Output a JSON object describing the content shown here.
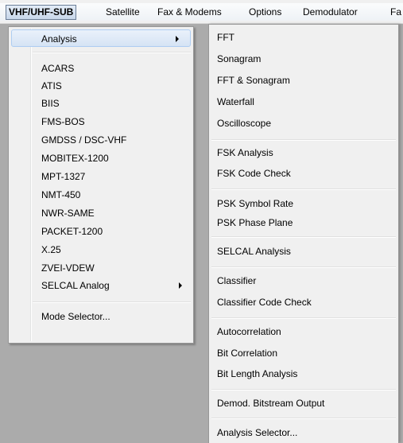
{
  "menubar": {
    "items": [
      {
        "label": "VHF/UHF-SUB"
      },
      {
        "label": "Satellite"
      },
      {
        "label": "Fax & Modems"
      },
      {
        "label": "Options"
      },
      {
        "label": "Demodulator"
      },
      {
        "label": "Fa"
      }
    ]
  },
  "left_menu": {
    "items": [
      {
        "label": "Analysis",
        "submenu": true
      },
      {
        "label": "ACARS"
      },
      {
        "label": "ATIS"
      },
      {
        "label": "BIIS"
      },
      {
        "label": "FMS-BOS"
      },
      {
        "label": "GMDSS / DSC-VHF"
      },
      {
        "label": "MOBITEX-1200"
      },
      {
        "label": "MPT-1327"
      },
      {
        "label": "NMT-450"
      },
      {
        "label": "NWR-SAME"
      },
      {
        "label": "PACKET-1200"
      },
      {
        "label": "X.25"
      },
      {
        "label": "ZVEI-VDEW"
      },
      {
        "label": "SELCAL Analog",
        "submenu": true
      },
      {
        "label": "Mode Selector..."
      }
    ]
  },
  "right_menu": {
    "items": [
      {
        "label": "FFT"
      },
      {
        "label": "Sonagram"
      },
      {
        "label": "FFT & Sonagram"
      },
      {
        "label": "Waterfall"
      },
      {
        "label": "Oscilloscope"
      },
      {
        "label": "FSK Analysis"
      },
      {
        "label": "FSK Code Check"
      },
      {
        "label": "PSK Symbol Rate"
      },
      {
        "label": "PSK Phase Plane"
      },
      {
        "label": "SELCAL Analysis"
      },
      {
        "label": "Classifier"
      },
      {
        "label": "Classifier Code Check"
      },
      {
        "label": "Autocorrelation"
      },
      {
        "label": "Bit Correlation"
      },
      {
        "label": "Bit Length Analysis"
      },
      {
        "label": "Demod. Bitstream Output"
      },
      {
        "label": "Analysis Selector..."
      }
    ]
  }
}
